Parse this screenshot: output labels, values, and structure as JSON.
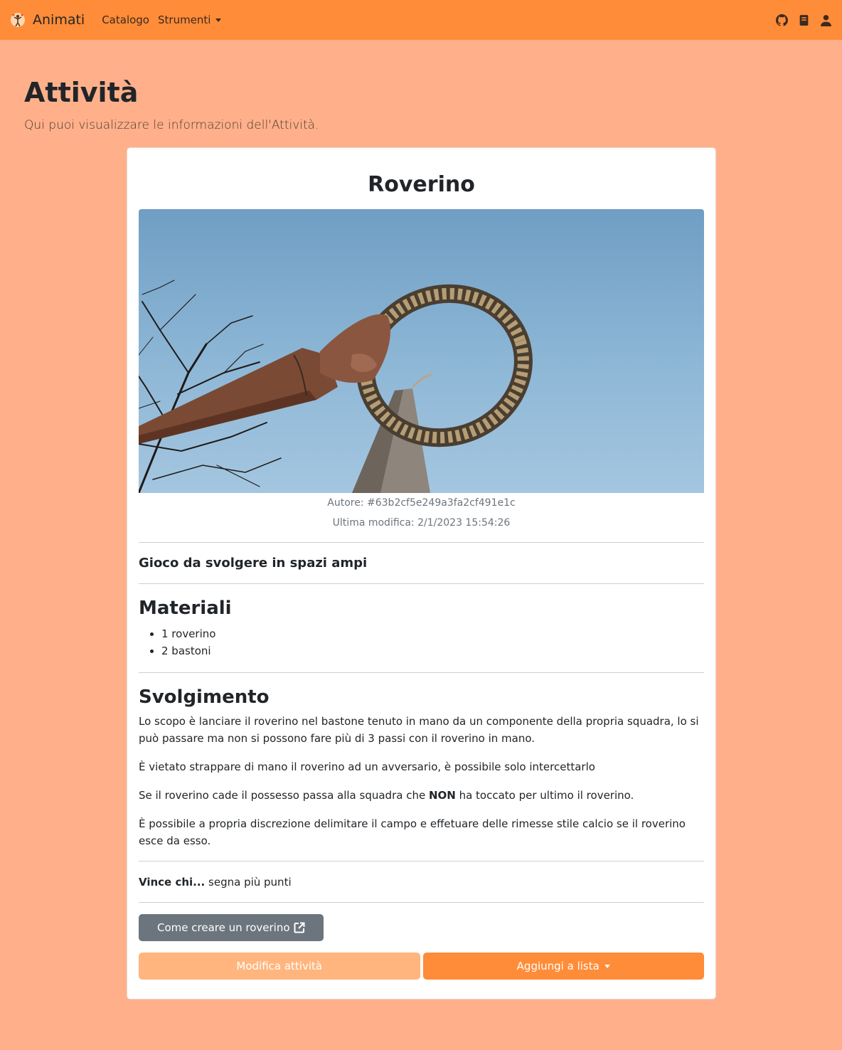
{
  "navbar": {
    "brand": "Animati",
    "links": [
      "Catalogo",
      "Strumenti"
    ]
  },
  "icons": {
    "brand_logo": "juggler-logo-icon",
    "github": "github-icon",
    "book": "book-icon",
    "user": "user-icon",
    "external": "external-link-icon"
  },
  "header": {
    "title": "Attività",
    "lead": "Qui puoi visualizzare le informazioni dell'Attività."
  },
  "activity": {
    "title": "Roverino",
    "author": "Autore: #63b2cf5e249a3fa2cf491e1c",
    "modified": "Ultima modifica: 2/1/2023 15:54:26",
    "category": "Gioco da svolgere in spazi ampi",
    "materials_heading": "Materiali",
    "materials": [
      "1 roverino",
      "2 bastoni"
    ],
    "procedure_heading": "Svolgimento",
    "p1": "Lo scopo è lanciare il roverino nel bastone tenuto in mano da un componente della propria squadra, lo si può passare ma non si possono fare più di 3 passi con il roverino in mano.",
    "p2": "È vietato strappare di mano il roverino ad un avversario, è possibile solo intercettarlo",
    "p3_before": "Se il roverino cade il possesso passa alla squadra che ",
    "p3_bold": "NON",
    "p3_after": " ha toccato per ultimo il roverino.",
    "p4": "È possibile a propria discrezione delimitare il campo e effetuare delle rimesse stile calcio se il roverino esce da esso.",
    "win_label": "Vince chi...",
    "win_text": " segna più punti"
  },
  "buttons": {
    "howto": "Come creare un roverino",
    "edit": "Modifica attività",
    "add": "Aggiungi a lista"
  },
  "colors": {
    "navbar": "#ff8c38",
    "background": "#ffb08a",
    "secondary_button": "#6c757d",
    "edit_button": "#ffb57d"
  }
}
